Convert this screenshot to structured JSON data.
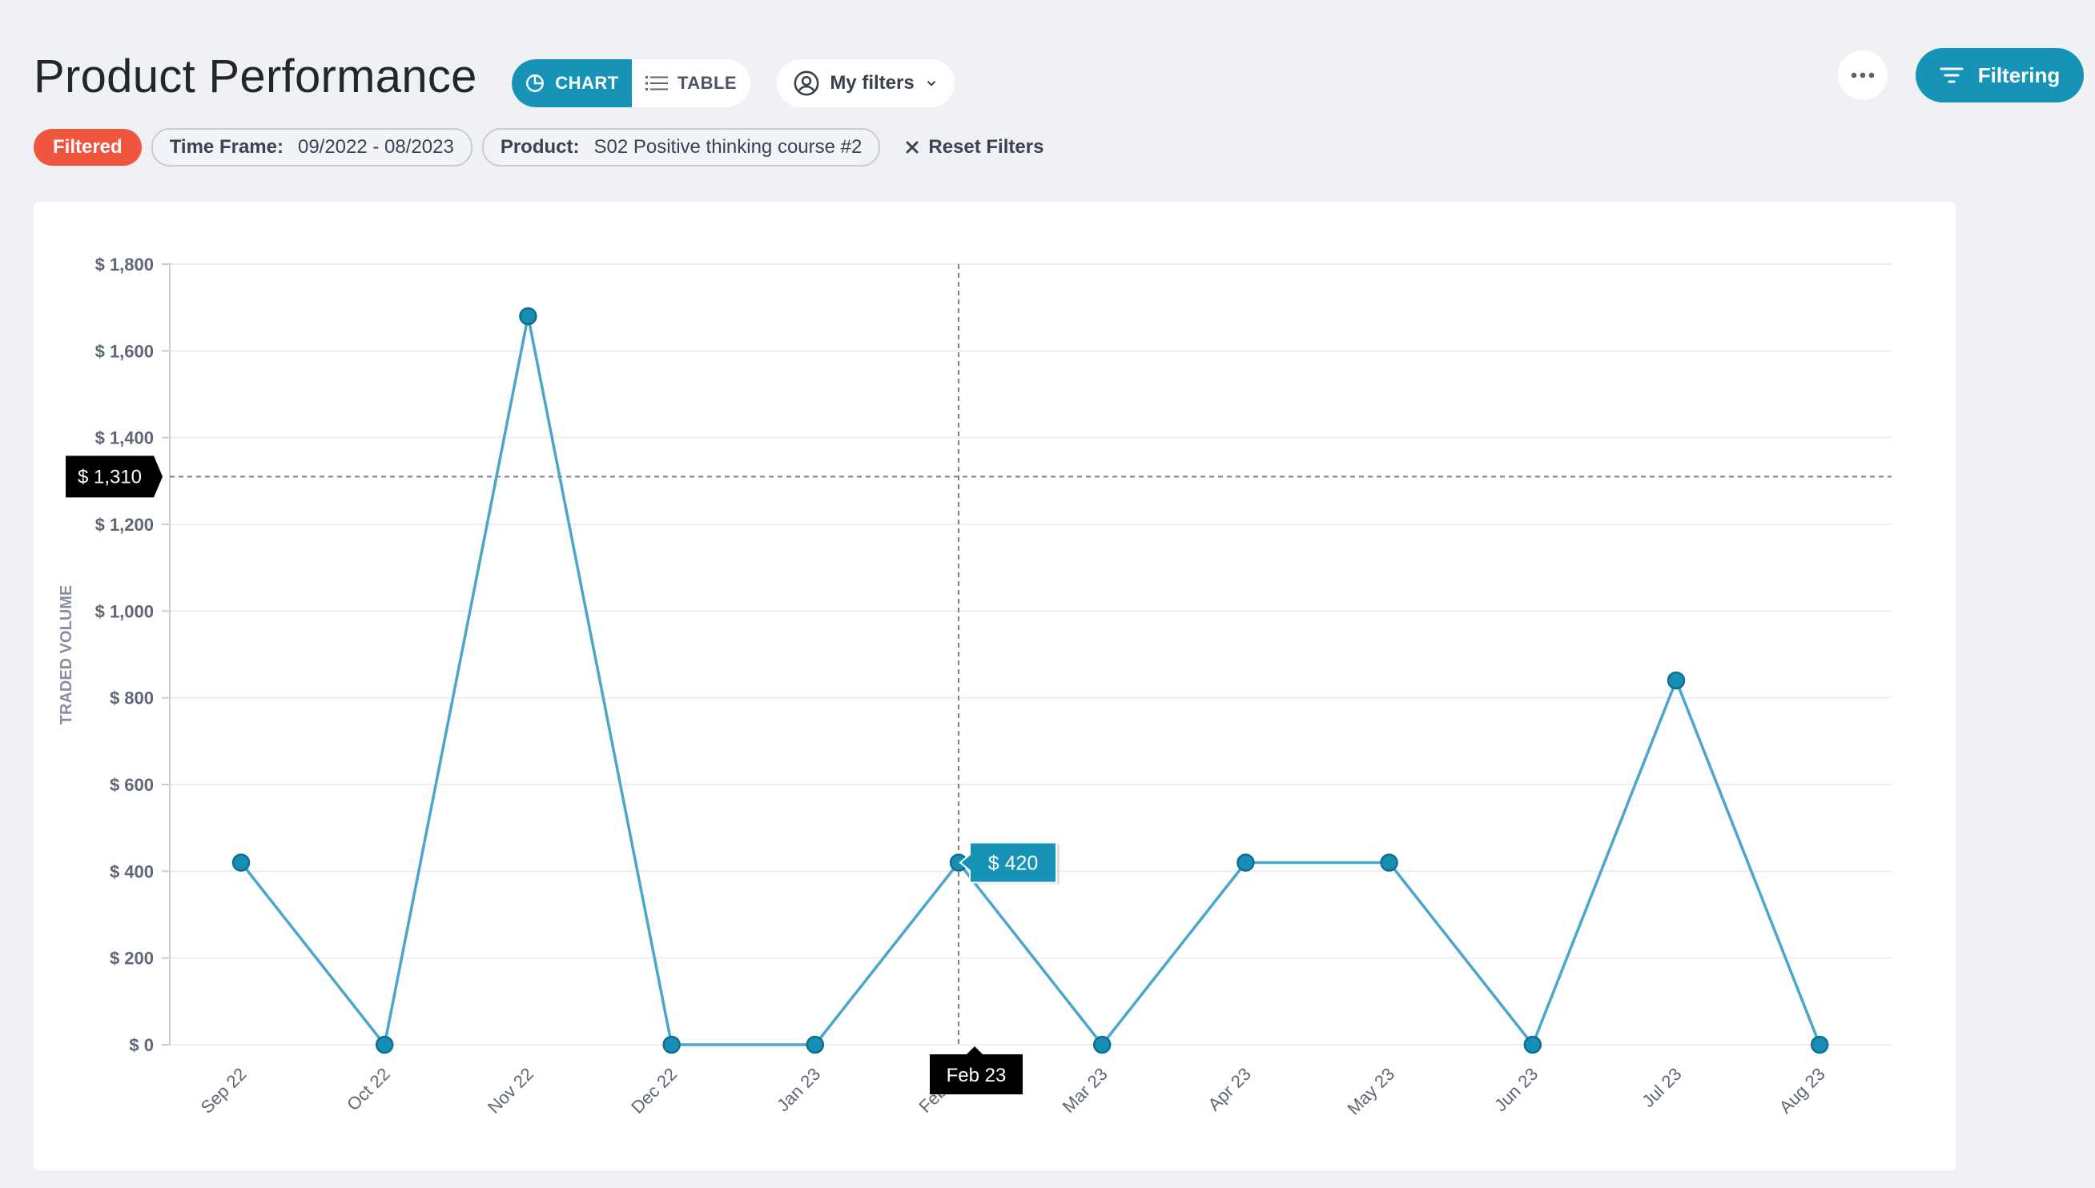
{
  "header": {
    "title": "Product Performance",
    "view_toggle": {
      "chart_label": "CHART",
      "table_label": "TABLE"
    },
    "my_filters_label": "My filters",
    "filtering_label": "Filtering"
  },
  "filters": {
    "status_label": "Filtered",
    "time_frame": {
      "key": "Time Frame:",
      "value": "09/2022 - 08/2023"
    },
    "product": {
      "key": "Product:",
      "value": "S02 Positive thinking course #2"
    },
    "reset_label": "Reset Filters"
  },
  "icons": {
    "chart_toggle": "pie-chart-icon",
    "table_toggle": "list-icon",
    "my_filters": "user-circle-icon",
    "dropdown": "chevron-down-icon",
    "more": "more-horizontal-icon",
    "filtering": "filter-lines-icon",
    "reset": "close-icon"
  },
  "colors": {
    "accent": "#1893b8",
    "line": "#4aa6cc",
    "point": "#178fb5",
    "filtered_badge": "#f0553d",
    "crosshair_label_bg": "#000000"
  },
  "chart_data": {
    "type": "line",
    "title": "",
    "xlabel": "",
    "ylabel": "TRADED VOLUME",
    "categories": [
      "Sep 22",
      "Oct 22",
      "Nov 22",
      "Dec 22",
      "Jan 23",
      "Feb 23",
      "Mar 23",
      "Apr 23",
      "May 23",
      "Jun 23",
      "Jul 23",
      "Aug 23"
    ],
    "series": [
      {
        "values": [
          420,
          0,
          1680,
          0,
          0,
          420,
          0,
          420,
          420,
          0,
          840,
          0
        ]
      }
    ],
    "ylim": [
      0,
      1800
    ],
    "yticks": [
      0,
      200,
      400,
      600,
      800,
      1000,
      1200,
      1400,
      1600,
      1800
    ],
    "ytick_labels": [
      "$ 0",
      "$ 200",
      "$ 400",
      "$ 600",
      "$ 800",
      "$ 1,000",
      "$ 1,200",
      "$ 1,400",
      "$ 1,600",
      "$ 1,800"
    ],
    "grid": true,
    "legend": "none",
    "crosshair": {
      "x_label": "Feb 23",
      "y_value": 1310,
      "y_label": "$ 1,310"
    },
    "tooltip": {
      "category": "Feb 23",
      "value": 420,
      "label": "$ 420"
    }
  }
}
